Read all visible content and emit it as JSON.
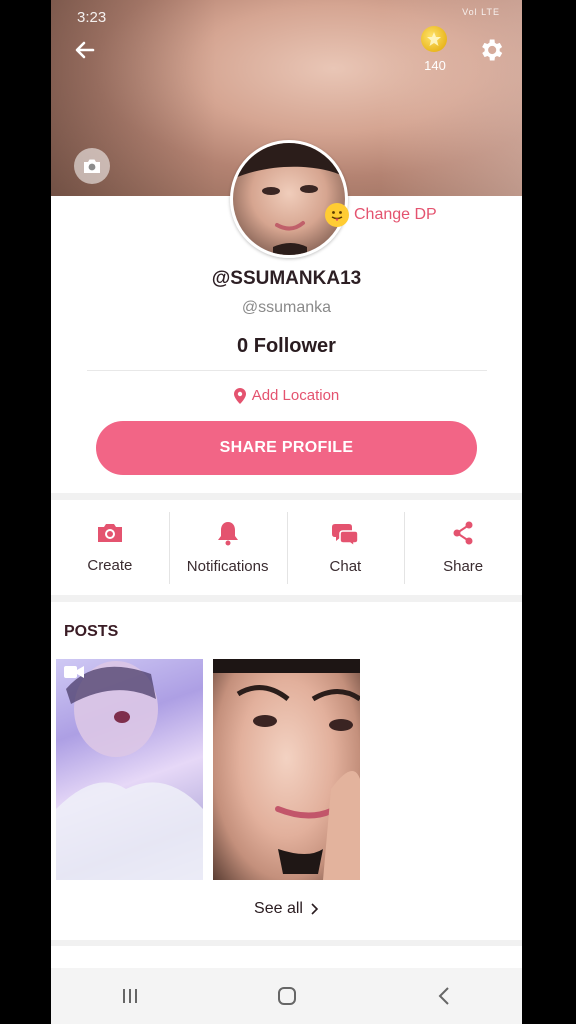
{
  "status_bar": {
    "time": "3:23",
    "indicators": "Vol LTE"
  },
  "header": {
    "coin_count": "140"
  },
  "profile": {
    "change_dp_label": "Change DP",
    "display_name": "@SSUMANKA13",
    "handle": "@ssumanka",
    "followers": "0 Follower",
    "add_location_label": "Add Location",
    "share_profile_label": "SHARE PROFILE"
  },
  "actions": [
    {
      "label": "Create",
      "icon": "camera-icon"
    },
    {
      "label": "Notifications",
      "icon": "bell-icon"
    },
    {
      "label": "Chat",
      "icon": "chat-icon"
    },
    {
      "label": "Share",
      "icon": "share-icon"
    }
  ],
  "posts": {
    "title": "POSTS",
    "see_all_label": "See all"
  },
  "colors": {
    "accent": "#f26586",
    "link": "#e4536f"
  }
}
